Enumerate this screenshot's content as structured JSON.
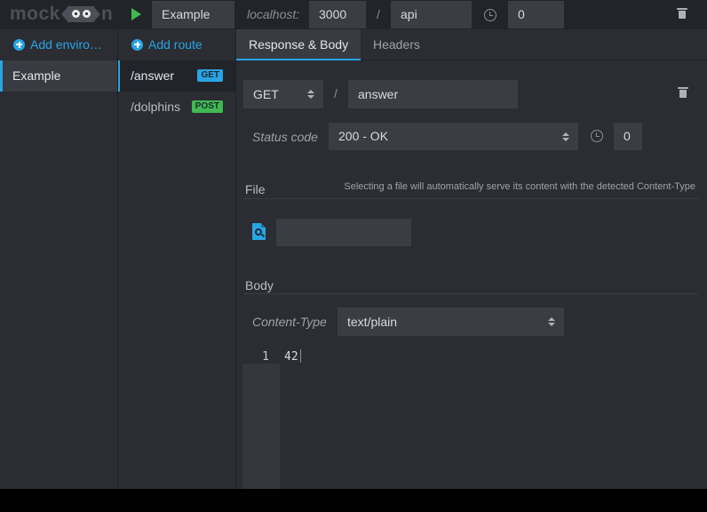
{
  "app": {
    "logo_left": "mock",
    "logo_right": "n"
  },
  "topbar": {
    "env_name": "Example",
    "host_label": "localhost:",
    "port": "3000",
    "separator": "/",
    "prefix": "api",
    "latency": "0"
  },
  "environments": {
    "add_label": "Add enviro…",
    "items": [
      {
        "label": "Example"
      }
    ]
  },
  "routes": {
    "add_label": "Add route",
    "items": [
      {
        "path": "/answer",
        "method": "GET"
      },
      {
        "path": "/dolphins",
        "method": "POST"
      }
    ]
  },
  "tabs": [
    {
      "label": "Response & Body"
    },
    {
      "label": "Headers"
    }
  ],
  "route_editor": {
    "method": "GET",
    "separator": "/",
    "path": "answer",
    "status_label": "Status code",
    "status_value": "200 - OK",
    "latency": "0"
  },
  "file_section": {
    "title": "File",
    "hint": "Selecting a file will automatically serve its content with the detected Content-Type",
    "path_value": ""
  },
  "body_section": {
    "title": "Body",
    "content_type_label": "Content-Type",
    "content_type_value": "text/plain",
    "lines": [
      {
        "number": "1",
        "text": "42"
      }
    ]
  },
  "colors": {
    "accent": "#29a4e4",
    "get_badge": "#29a4e4",
    "post_badge": "#3fb950",
    "play": "#3fb950"
  }
}
